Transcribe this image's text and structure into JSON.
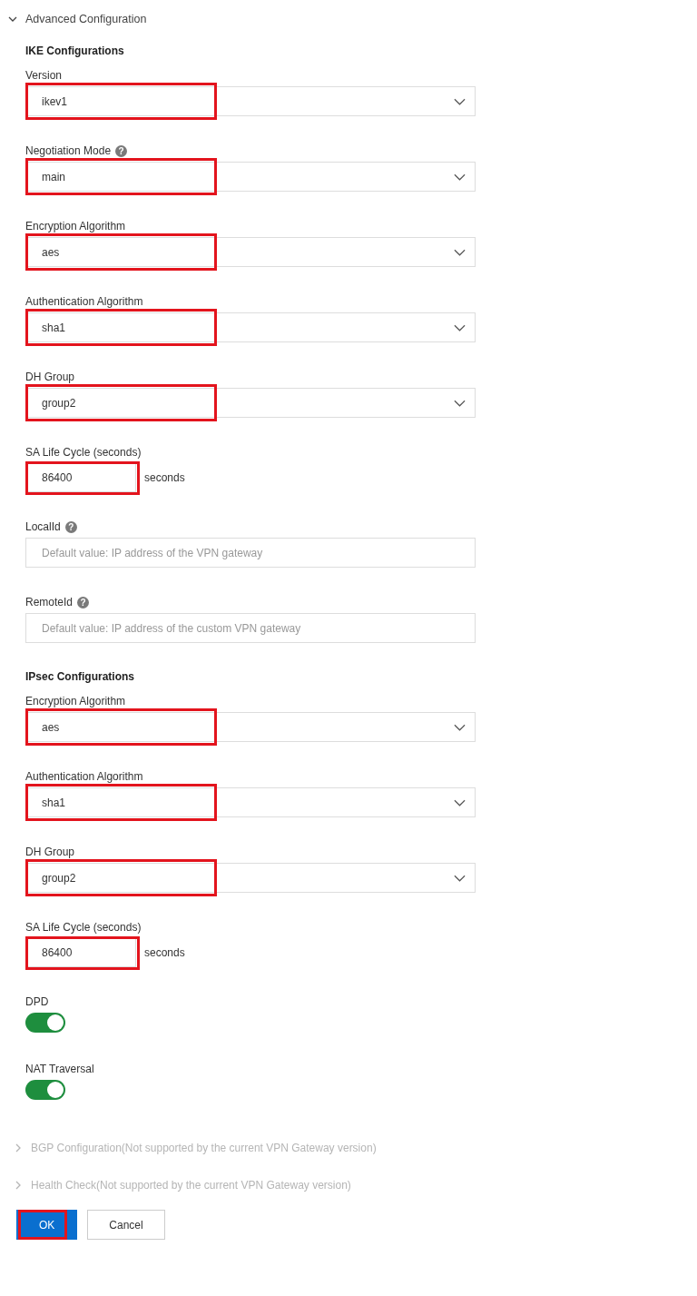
{
  "advanced": {
    "label": "Advanced Configuration",
    "expanded": true,
    "disabled": false
  },
  "sections": [
    {
      "title": "IKE Configurations",
      "fields": [
        {
          "kind": "select",
          "label": "Version",
          "value": "ikev1",
          "highlighted": true
        },
        {
          "kind": "select",
          "label": "Negotiation Mode",
          "help": "?",
          "value": "main",
          "highlighted": true
        },
        {
          "kind": "select",
          "label": "Encryption Algorithm",
          "value": "aes",
          "highlighted": true
        },
        {
          "kind": "select",
          "label": "Authentication Algorithm",
          "value": "sha1",
          "highlighted": true
        },
        {
          "kind": "select",
          "label": "DH Group",
          "value": "group2",
          "highlighted": true
        },
        {
          "kind": "number",
          "label": "SA Life Cycle (seconds)",
          "value": "86400",
          "unit": "seconds",
          "highlighted": true
        },
        {
          "kind": "text",
          "label": "LocalId",
          "help": "?",
          "placeholder": "Default value: IP address of the VPN gateway",
          "highlighted": false
        },
        {
          "kind": "text",
          "label": "RemoteId",
          "help": "?",
          "placeholder": "Default value: IP address of the custom VPN gateway",
          "highlighted": false
        }
      ]
    },
    {
      "title": "IPsec Configurations",
      "fields": [
        {
          "kind": "select",
          "label": "Encryption Algorithm",
          "value": "aes",
          "highlighted": true
        },
        {
          "kind": "select",
          "label": "Authentication Algorithm",
          "value": "sha1",
          "highlighted": true
        },
        {
          "kind": "select",
          "label": "DH Group",
          "value": "group2",
          "highlighted": true
        },
        {
          "kind": "number",
          "label": "SA Life Cycle (seconds)",
          "value": "86400",
          "unit": "seconds",
          "highlighted": true
        },
        {
          "kind": "toggle",
          "label": "DPD",
          "on": true,
          "highlighted": false
        },
        {
          "kind": "toggle",
          "label": "NAT Traversal",
          "on": true,
          "highlighted": false
        }
      ]
    }
  ],
  "collapsed": [
    {
      "label": "BGP Configuration(Not supported by the current VPN Gateway version)",
      "expanded": false,
      "disabled": true
    },
    {
      "label": "Health Check(Not supported by the current VPN Gateway version)",
      "expanded": false,
      "disabled": true
    }
  ],
  "buttons": [
    {
      "label": "OK",
      "kind": "primary",
      "highlighted": true
    },
    {
      "label": "Cancel",
      "kind": "secondary",
      "highlighted": false
    }
  ]
}
